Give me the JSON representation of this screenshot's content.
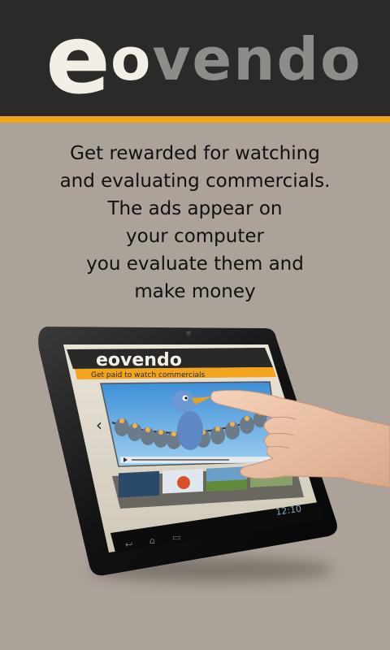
{
  "header": {
    "logo_e": "e",
    "logo_o": "o",
    "logo_vendo": "vendo",
    "accent_color": "#f2a41c",
    "background_color": "#2b2a29"
  },
  "tagline": {
    "lines": [
      "Get rewarded for watching",
      "and evaluating commercials.",
      "The ads appear on",
      "your computer",
      "you evaluate them and",
      "make money"
    ]
  },
  "tablet_illustration": {
    "app_logo": "eovendo",
    "app_subtitle": "Get paid to watch commercials",
    "clock": "12:10"
  }
}
